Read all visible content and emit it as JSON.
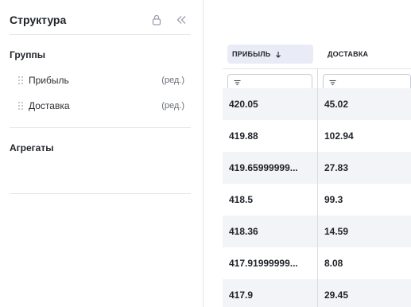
{
  "structure_panel": {
    "title": "Структура",
    "groups_title": "Группы",
    "groups": [
      {
        "label": "Прибыль",
        "edit": "(ред.)"
      },
      {
        "label": "Доставка",
        "edit": "(ред.)"
      }
    ],
    "aggregates_title": "Агрегаты"
  },
  "table": {
    "columns": [
      {
        "label": "ПРИБЫЛЬ",
        "sorted": "descending"
      },
      {
        "label": "ДОСТАВКА"
      }
    ],
    "rows": [
      [
        "420.05",
        "45.02"
      ],
      [
        "419.88",
        "102.94"
      ],
      [
        "419.65999999...",
        "27.83"
      ],
      [
        "418.5",
        "99.3"
      ],
      [
        "418.36",
        "14.59"
      ],
      [
        "417.91999999...",
        "8.08"
      ],
      [
        "417.9",
        "29.45"
      ]
    ]
  },
  "icons": {
    "lock": "lock-icon",
    "collapse": "double-chevron-left-icon",
    "drag": "drag-handle-icon",
    "filter": "filter-icon",
    "sort": "arrow-down-icon"
  },
  "colors": {
    "sorted_header_bg": "#e9ecf6",
    "shaded_row_bg": "#f3f4f7",
    "border": "#e3e5e8"
  }
}
